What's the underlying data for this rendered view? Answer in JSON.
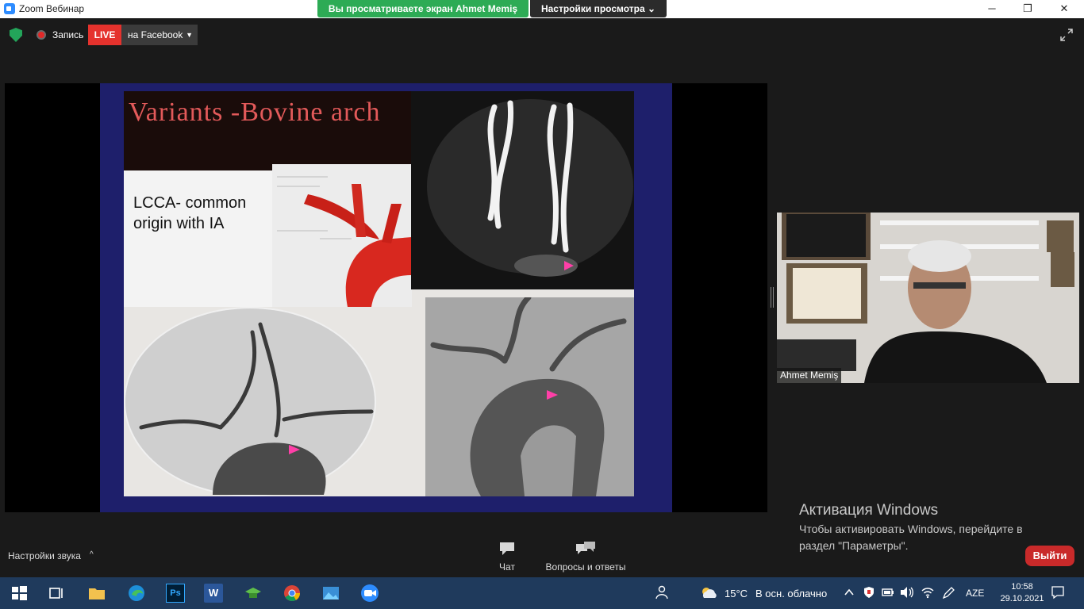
{
  "window": {
    "title": "Zoom Вебинар",
    "minimize_glyph": "─",
    "maximize_glyph": "❐",
    "close_glyph": "✕"
  },
  "share_banner": {
    "message": "Вы просматриваете экран Ahmet Memiş",
    "view_options_label": "Настройки просмотра ⌄"
  },
  "top_bar": {
    "recording_label": "Запись",
    "live_label": "LIVE",
    "stream_target_label": "на Facebook",
    "stream_chevron": "▼"
  },
  "slide": {
    "title": "Variants -Bovine arch",
    "subtitle": "LCCA- common origin with IA"
  },
  "speaker": {
    "name": "Ahmet Memiş"
  },
  "activation": {
    "title": "Активация Windows",
    "text": "Чтобы активировать Windows, перейдите в раздел \"Параметры\"."
  },
  "controls": {
    "audio_settings_label": "Настройки звука",
    "audio_chevron": "^",
    "chat_label": "Чат",
    "qa_label": "Вопросы и ответы",
    "exit_label": "Выйти"
  },
  "taskbar": {
    "apps": [
      "windows-start",
      "task-view",
      "file-explorer",
      "edge",
      "photoshop",
      "word",
      "app-green",
      "chrome",
      "photos",
      "zoom"
    ],
    "ps_label": "Ps",
    "word_label": "W",
    "weather_temp": "15°C",
    "weather_desc": "В осн. облачно",
    "language": "AZE",
    "time": "10:58",
    "date": "29.10.2021"
  },
  "colors": {
    "live_red": "#e5322d",
    "share_green": "#2dab55",
    "exit_red": "#c92a2a",
    "taskbar_blue": "#1f3a5c"
  }
}
